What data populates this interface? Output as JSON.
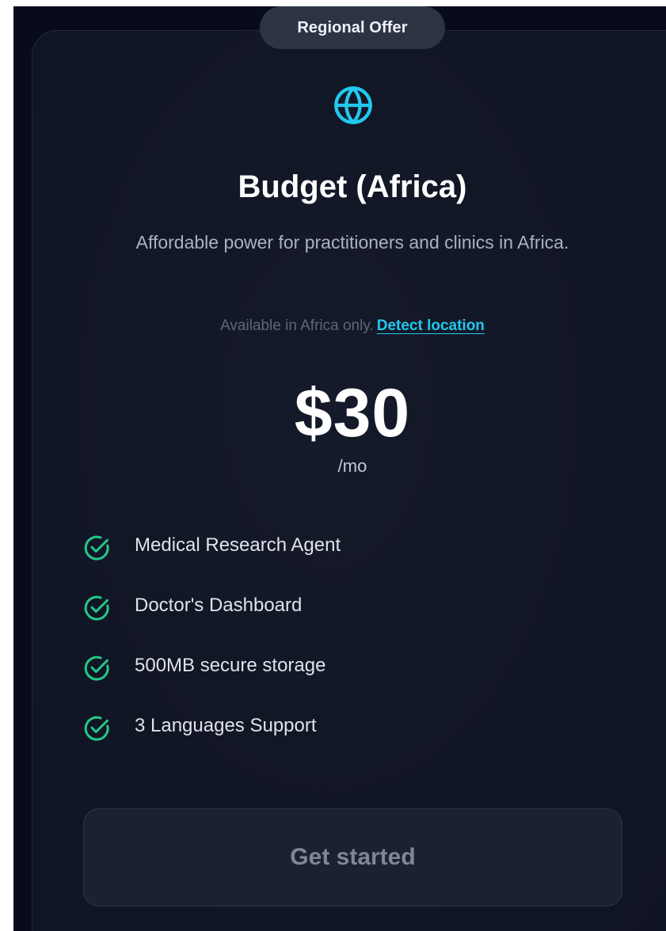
{
  "badge": {
    "label": "Regional Offer"
  },
  "plan": {
    "icon": "globe-icon",
    "title": "Budget (Africa)",
    "description": "Affordable power for practitioners and clinics in Africa.",
    "availability_text": "Available in Africa only.",
    "detect_link": "Detect location",
    "price": "$30",
    "period": "/mo"
  },
  "features": [
    {
      "icon": "check-circle-icon",
      "label": "Medical Research Agent"
    },
    {
      "icon": "check-circle-icon",
      "label": "Doctor's Dashboard"
    },
    {
      "icon": "check-circle-icon",
      "label": "500MB secure storage"
    },
    {
      "icon": "check-circle-icon",
      "label": "3 Languages Support"
    }
  ],
  "cta": {
    "label": "Get started"
  },
  "colors": {
    "background": "#070b1a",
    "card": "#121726",
    "accent": "#22c8ee",
    "check": "#22c98a",
    "button": "#1c2131"
  }
}
